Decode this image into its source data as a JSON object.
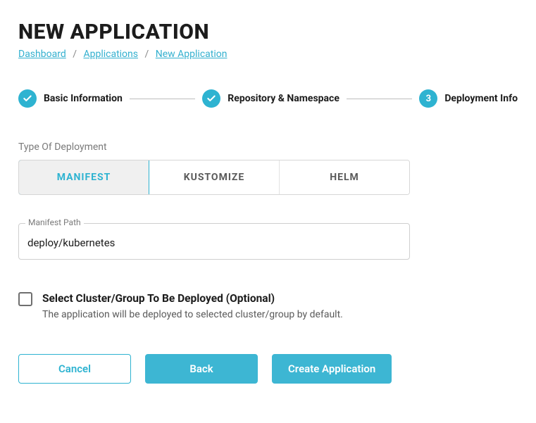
{
  "header": {
    "title": "NEW APPLICATION"
  },
  "breadcrumb": {
    "items": [
      "Dashboard",
      "Applications",
      "New Application"
    ],
    "separator": "/"
  },
  "stepper": {
    "steps": [
      {
        "label": "Basic Information",
        "state": "done"
      },
      {
        "label": "Repository & Namespace",
        "state": "done"
      },
      {
        "label": "Deployment Info",
        "state": "current",
        "number": "3"
      }
    ]
  },
  "deployment_type": {
    "label": "Type Of Deployment",
    "options": [
      {
        "label": "MANIFEST",
        "active": true
      },
      {
        "label": "KUSTOMIZE",
        "active": false
      },
      {
        "label": "HELM",
        "active": false
      }
    ]
  },
  "manifest_path": {
    "label": "Manifest Path",
    "value": "deploy/kubernetes"
  },
  "cluster_select": {
    "title": "Select Cluster/Group To Be Deployed (Optional)",
    "description": "The application will be deployed to selected cluster/group by default.",
    "checked": false
  },
  "buttons": {
    "cancel": "Cancel",
    "back": "Back",
    "submit": "Create Application"
  },
  "colors": {
    "accent": "#2eb3d1"
  }
}
